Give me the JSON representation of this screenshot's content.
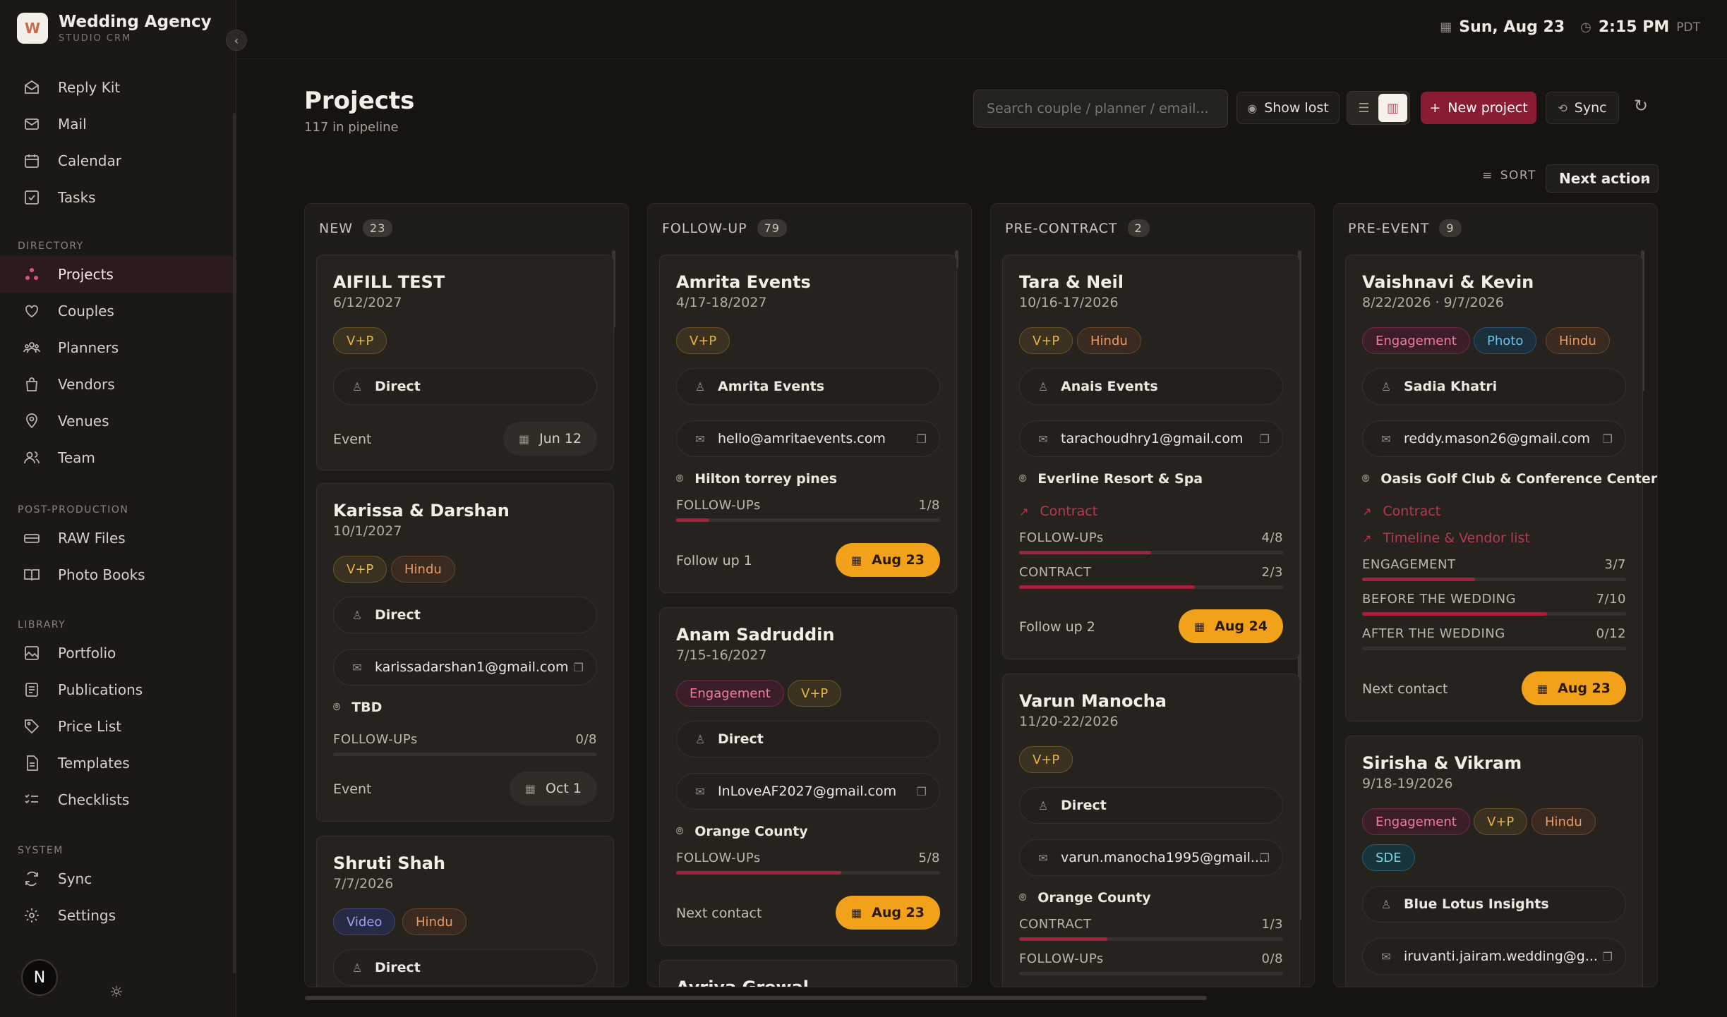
{
  "brand": {
    "name": "Wedding Agency",
    "sub": "STUDIO CRM",
    "logo_text": "W"
  },
  "nav": {
    "top": [
      {
        "label": "Reply Kit",
        "icon": "reply-kit-icon"
      },
      {
        "label": "Mail",
        "icon": "mail-icon"
      },
      {
        "label": "Calendar",
        "icon": "calendar-icon"
      },
      {
        "label": "Tasks",
        "icon": "tasks-icon"
      }
    ],
    "sections": [
      {
        "title": "DIRECTORY",
        "items": [
          {
            "label": "Projects",
            "icon": "projects-icon",
            "active": true
          },
          {
            "label": "Couples",
            "icon": "heart-icon"
          },
          {
            "label": "Planners",
            "icon": "planners-icon"
          },
          {
            "label": "Vendors",
            "icon": "bag-icon"
          },
          {
            "label": "Venues",
            "icon": "location-icon"
          },
          {
            "label": "Team",
            "icon": "team-icon"
          }
        ]
      },
      {
        "title": "POST-PRODUCTION",
        "items": [
          {
            "label": "RAW Files",
            "icon": "drive-icon"
          },
          {
            "label": "Photo Books",
            "icon": "book-icon"
          }
        ]
      },
      {
        "title": "LIBRARY",
        "items": [
          {
            "label": "Portfolio",
            "icon": "portfolio-icon"
          },
          {
            "label": "Publications",
            "icon": "publications-icon"
          },
          {
            "label": "Price List",
            "icon": "tag-icon"
          },
          {
            "label": "Templates",
            "icon": "template-icon"
          },
          {
            "label": "Checklists",
            "icon": "checklist-icon"
          }
        ]
      },
      {
        "title": "SYSTEM",
        "items": [
          {
            "label": "Sync",
            "icon": "sync-icon"
          },
          {
            "label": "Settings",
            "icon": "gear-icon"
          }
        ]
      }
    ],
    "avatar": "N"
  },
  "topbar": {
    "date": "Sun, Aug 23",
    "time": "2:15 PM",
    "tz": "PDT"
  },
  "header": {
    "title": "Projects",
    "subtitle": "117 in pipeline",
    "search_placeholder": "Search couple / planner / email...",
    "show_lost": "Show lost",
    "new_project": "New project",
    "sync": "Sync",
    "sort_label": "SORT",
    "sort_value": "Next action"
  },
  "columns": [
    {
      "name": "NEW",
      "count": "23"
    },
    {
      "name": "FOLLOW-UP",
      "count": "79"
    },
    {
      "name": "PRE-CONTRACT",
      "count": "2"
    },
    {
      "name": "PRE-EVENT",
      "count": "9"
    }
  ],
  "cards": {
    "aifill": {
      "title": "AIFILL TEST",
      "date": "6/12/2027",
      "tags": [
        "V+P"
      ],
      "planner": "Direct",
      "foot": "Event",
      "chip": "Jun 12"
    },
    "karissa": {
      "title": "Karissa & Darshan",
      "date": "10/1/2027",
      "tags": [
        "V+P",
        "Hindu"
      ],
      "planner": "Direct",
      "email": "karissadarshan1@gmail.com",
      "venue": "TBD",
      "p1": {
        "label": "FOLLOW-UPs",
        "value": "0/8",
        "fraction": 0
      },
      "foot": "Event",
      "chip": "Oct 1"
    },
    "shruti": {
      "title": "Shruti Shah",
      "date": "7/7/2026",
      "tags": [
        "Video",
        "Hindu"
      ],
      "planner": "Direct"
    },
    "amrita": {
      "title": "Amrita Events",
      "date": "4/17-18/2027",
      "tags": [
        "V+P"
      ],
      "planner": "Amrita Events",
      "email": "hello@amritaevents.com",
      "venue": "Hilton torrey pines",
      "p1": {
        "label": "FOLLOW-UPs",
        "value": "1/8",
        "fraction": 0.125
      },
      "foot": "Follow up 1",
      "chip": "Aug 23"
    },
    "anam": {
      "title": "Anam Sadruddin",
      "date": "7/15-16/2027",
      "tags": [
        "Engagement",
        "V+P"
      ],
      "planner": "Direct",
      "email": "InLoveAF2027@gmail.com",
      "venue": "Orange County",
      "p1": {
        "label": "FOLLOW-UPs",
        "value": "5/8",
        "fraction": 0.625
      },
      "foot": "Next contact",
      "chip": "Aug 23"
    },
    "avriya": {
      "title": "Avriya Grewal"
    },
    "tara": {
      "title": "Tara & Neil",
      "date": "10/16-17/2026",
      "tags": [
        "V+P",
        "Hindu"
      ],
      "planner": "Anais Events",
      "email": "tarachoudhry1@gmail.com",
      "venue": "Everline Resort & Spa",
      "link1": "Contract",
      "p1": {
        "label": "FOLLOW-UPs",
        "value": "4/8",
        "fraction": 0.5
      },
      "p2": {
        "label": "CONTRACT",
        "value": "2/3",
        "fraction": 0.667
      },
      "foot": "Follow up 2",
      "chip": "Aug 24"
    },
    "varun": {
      "title": "Varun Manocha",
      "date": "11/20-22/2026",
      "tags": [
        "V+P"
      ],
      "planner": "Direct",
      "email": "varun.manocha1995@gmail....",
      "venue": "Orange County",
      "p1": {
        "label": "CONTRACT",
        "value": "1/3",
        "fraction": 0.333
      },
      "p2": {
        "label": "FOLLOW-UPs",
        "value": "0/8",
        "fraction": 0
      }
    },
    "vaishnavi": {
      "title": "Vaishnavi & Kevin",
      "date": "8/22/2026 · 9/7/2026",
      "tags": [
        "Engagement",
        "Photo",
        "Hindu"
      ],
      "planner": "Sadia Khatri",
      "email": "reddy.mason26@gmail.com",
      "venue": "Oasis Golf Club & Conference Center",
      "link1": "Contract",
      "link2": "Timeline & Vendor list",
      "p1": {
        "label": "ENGAGEMENT",
        "value": "3/7",
        "fraction": 0.429
      },
      "p2": {
        "label": "BEFORE THE WEDDING",
        "value": "7/10",
        "fraction": 0.7
      },
      "p3": {
        "label": "AFTER THE WEDDING",
        "value": "0/12",
        "fraction": 0
      },
      "foot": "Next contact",
      "chip": "Aug 23"
    },
    "sirisha": {
      "title": "Sirisha & Vikram",
      "date": "9/18-19/2026",
      "tags": [
        "Engagement",
        "V+P",
        "Hindu",
        "SDE"
      ],
      "planner": "Blue Lotus Insights",
      "email": "iruvanti.jairam.wedding@g..."
    }
  }
}
